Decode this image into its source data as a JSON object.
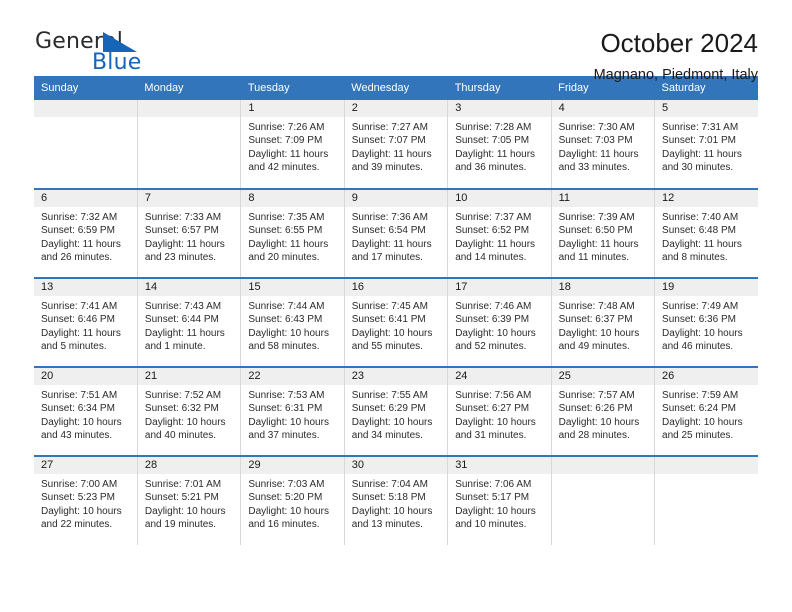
{
  "brand": {
    "name_part1": "General",
    "name_part2": "Blue",
    "logo_icon": "blue-triangle-flag",
    "accent_color": "#1565b8"
  },
  "header": {
    "title": "October 2024",
    "subtitle": "Magnano, Piedmont, Italy"
  },
  "theme": {
    "header_blue": "#3275bb",
    "band_gray": "#efefef",
    "cell_border": "#d8d8d8"
  },
  "calendar": {
    "weekday_headers": [
      "Sunday",
      "Monday",
      "Tuesday",
      "Wednesday",
      "Thursday",
      "Friday",
      "Saturday"
    ],
    "weeks": [
      [
        {
          "day": "",
          "empty": true
        },
        {
          "day": "",
          "empty": true
        },
        {
          "day": "1",
          "sunrise": "Sunrise: 7:26 AM",
          "sunset": "Sunset: 7:09 PM",
          "daylight": "Daylight: 11 hours and 42 minutes."
        },
        {
          "day": "2",
          "sunrise": "Sunrise: 7:27 AM",
          "sunset": "Sunset: 7:07 PM",
          "daylight": "Daylight: 11 hours and 39 minutes."
        },
        {
          "day": "3",
          "sunrise": "Sunrise: 7:28 AM",
          "sunset": "Sunset: 7:05 PM",
          "daylight": "Daylight: 11 hours and 36 minutes."
        },
        {
          "day": "4",
          "sunrise": "Sunrise: 7:30 AM",
          "sunset": "Sunset: 7:03 PM",
          "daylight": "Daylight: 11 hours and 33 minutes."
        },
        {
          "day": "5",
          "sunrise": "Sunrise: 7:31 AM",
          "sunset": "Sunset: 7:01 PM",
          "daylight": "Daylight: 11 hours and 30 minutes."
        }
      ],
      [
        {
          "day": "6",
          "sunrise": "Sunrise: 7:32 AM",
          "sunset": "Sunset: 6:59 PM",
          "daylight": "Daylight: 11 hours and 26 minutes."
        },
        {
          "day": "7",
          "sunrise": "Sunrise: 7:33 AM",
          "sunset": "Sunset: 6:57 PM",
          "daylight": "Daylight: 11 hours and 23 minutes."
        },
        {
          "day": "8",
          "sunrise": "Sunrise: 7:35 AM",
          "sunset": "Sunset: 6:55 PM",
          "daylight": "Daylight: 11 hours and 20 minutes."
        },
        {
          "day": "9",
          "sunrise": "Sunrise: 7:36 AM",
          "sunset": "Sunset: 6:54 PM",
          "daylight": "Daylight: 11 hours and 17 minutes."
        },
        {
          "day": "10",
          "sunrise": "Sunrise: 7:37 AM",
          "sunset": "Sunset: 6:52 PM",
          "daylight": "Daylight: 11 hours and 14 minutes."
        },
        {
          "day": "11",
          "sunrise": "Sunrise: 7:39 AM",
          "sunset": "Sunset: 6:50 PM",
          "daylight": "Daylight: 11 hours and 11 minutes."
        },
        {
          "day": "12",
          "sunrise": "Sunrise: 7:40 AM",
          "sunset": "Sunset: 6:48 PM",
          "daylight": "Daylight: 11 hours and 8 minutes."
        }
      ],
      [
        {
          "day": "13",
          "sunrise": "Sunrise: 7:41 AM",
          "sunset": "Sunset: 6:46 PM",
          "daylight": "Daylight: 11 hours and 5 minutes."
        },
        {
          "day": "14",
          "sunrise": "Sunrise: 7:43 AM",
          "sunset": "Sunset: 6:44 PM",
          "daylight": "Daylight: 11 hours and 1 minute."
        },
        {
          "day": "15",
          "sunrise": "Sunrise: 7:44 AM",
          "sunset": "Sunset: 6:43 PM",
          "daylight": "Daylight: 10 hours and 58 minutes."
        },
        {
          "day": "16",
          "sunrise": "Sunrise: 7:45 AM",
          "sunset": "Sunset: 6:41 PM",
          "daylight": "Daylight: 10 hours and 55 minutes."
        },
        {
          "day": "17",
          "sunrise": "Sunrise: 7:46 AM",
          "sunset": "Sunset: 6:39 PM",
          "daylight": "Daylight: 10 hours and 52 minutes."
        },
        {
          "day": "18",
          "sunrise": "Sunrise: 7:48 AM",
          "sunset": "Sunset: 6:37 PM",
          "daylight": "Daylight: 10 hours and 49 minutes."
        },
        {
          "day": "19",
          "sunrise": "Sunrise: 7:49 AM",
          "sunset": "Sunset: 6:36 PM",
          "daylight": "Daylight: 10 hours and 46 minutes."
        }
      ],
      [
        {
          "day": "20",
          "sunrise": "Sunrise: 7:51 AM",
          "sunset": "Sunset: 6:34 PM",
          "daylight": "Daylight: 10 hours and 43 minutes."
        },
        {
          "day": "21",
          "sunrise": "Sunrise: 7:52 AM",
          "sunset": "Sunset: 6:32 PM",
          "daylight": "Daylight: 10 hours and 40 minutes."
        },
        {
          "day": "22",
          "sunrise": "Sunrise: 7:53 AM",
          "sunset": "Sunset: 6:31 PM",
          "daylight": "Daylight: 10 hours and 37 minutes."
        },
        {
          "day": "23",
          "sunrise": "Sunrise: 7:55 AM",
          "sunset": "Sunset: 6:29 PM",
          "daylight": "Daylight: 10 hours and 34 minutes."
        },
        {
          "day": "24",
          "sunrise": "Sunrise: 7:56 AM",
          "sunset": "Sunset: 6:27 PM",
          "daylight": "Daylight: 10 hours and 31 minutes."
        },
        {
          "day": "25",
          "sunrise": "Sunrise: 7:57 AM",
          "sunset": "Sunset: 6:26 PM",
          "daylight": "Daylight: 10 hours and 28 minutes."
        },
        {
          "day": "26",
          "sunrise": "Sunrise: 7:59 AM",
          "sunset": "Sunset: 6:24 PM",
          "daylight": "Daylight: 10 hours and 25 minutes."
        }
      ],
      [
        {
          "day": "27",
          "sunrise": "Sunrise: 7:00 AM",
          "sunset": "Sunset: 5:23 PM",
          "daylight": "Daylight: 10 hours and 22 minutes."
        },
        {
          "day": "28",
          "sunrise": "Sunrise: 7:01 AM",
          "sunset": "Sunset: 5:21 PM",
          "daylight": "Daylight: 10 hours and 19 minutes."
        },
        {
          "day": "29",
          "sunrise": "Sunrise: 7:03 AM",
          "sunset": "Sunset: 5:20 PM",
          "daylight": "Daylight: 10 hours and 16 minutes."
        },
        {
          "day": "30",
          "sunrise": "Sunrise: 7:04 AM",
          "sunset": "Sunset: 5:18 PM",
          "daylight": "Daylight: 10 hours and 13 minutes."
        },
        {
          "day": "31",
          "sunrise": "Sunrise: 7:06 AM",
          "sunset": "Sunset: 5:17 PM",
          "daylight": "Daylight: 10 hours and 10 minutes."
        },
        {
          "day": "",
          "empty": true
        },
        {
          "day": "",
          "empty": true
        }
      ]
    ]
  }
}
